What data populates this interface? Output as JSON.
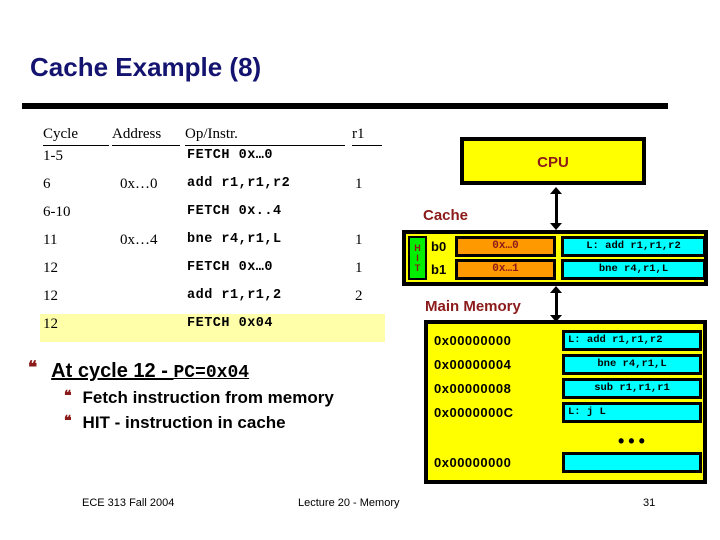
{
  "slide": {
    "title": "Cache Example (8)"
  },
  "trace_table": {
    "headers": {
      "cycle": "Cycle",
      "address": "Address",
      "op": "Op/Instr.",
      "r1": "r1"
    },
    "rows": [
      {
        "cycle": "1-5",
        "address": "",
        "op": "FETCH 0x…0",
        "r1": ""
      },
      {
        "cycle": "6",
        "address": "0x…0",
        "op": "add r1,r1,r2",
        "r1": "1"
      },
      {
        "cycle": "6-10",
        "address": "",
        "op": "FETCH 0x..4",
        "r1": ""
      },
      {
        "cycle": "11",
        "address": "0x…4",
        "op": "bne r4,r1,L",
        "r1": "1"
      },
      {
        "cycle": "12",
        "address": "",
        "op": "FETCH 0x…0",
        "r1": "1"
      },
      {
        "cycle": "12",
        "address": "",
        "op": "add r1,r1,2",
        "r1": "2"
      },
      {
        "cycle": "12",
        "address": "",
        "op": "FETCH 0x04",
        "r1": "",
        "highlight": true
      }
    ]
  },
  "bullets": {
    "glyph": "❝",
    "main_prefix": "At cycle 12 - ",
    "main_mono": "PC=0x04",
    "sub": [
      "Fetch instruction from memory",
      "HIT - instruction in cache"
    ]
  },
  "diagram": {
    "cpu_label": "CPU",
    "cache_label": "Cache",
    "memory_label": "Main Memory",
    "hit_letters": [
      "H",
      "I",
      "T"
    ],
    "cache_rows": [
      {
        "block": "b0",
        "tag": "0x…0",
        "instr": "L: add r1,r1,r2"
      },
      {
        "block": "b1",
        "tag": "0x…1",
        "instr": "bne r4,r1,L"
      }
    ],
    "memory_rows": [
      {
        "address": "0x00000000",
        "instr": "L: add r1,r1,r2",
        "align": "left"
      },
      {
        "address": "0x00000004",
        "instr": "bne r4,r1,L",
        "align": "center"
      },
      {
        "address": "0x00000008",
        "instr": "sub r1,r1,r1",
        "align": "center"
      },
      {
        "address": "0x0000000C",
        "instr": "L: j L",
        "align": "left"
      },
      {
        "address": "0x00000000",
        "instr": "",
        "align": "center"
      }
    ],
    "memory_ellipsis": "•••"
  },
  "footer": {
    "left": "ECE 313 Fall 2004",
    "center": "Lecture 20 - Memory",
    "right": "31"
  },
  "colors": {
    "title": "#141470",
    "accent_red": "#8b1a1a",
    "box_yellow": "#ffff00",
    "tag_orange": "#ff9900",
    "instr_cyan": "#00ffff",
    "hit_green": "#00ee00",
    "row_highlight": "#ffffaa"
  }
}
